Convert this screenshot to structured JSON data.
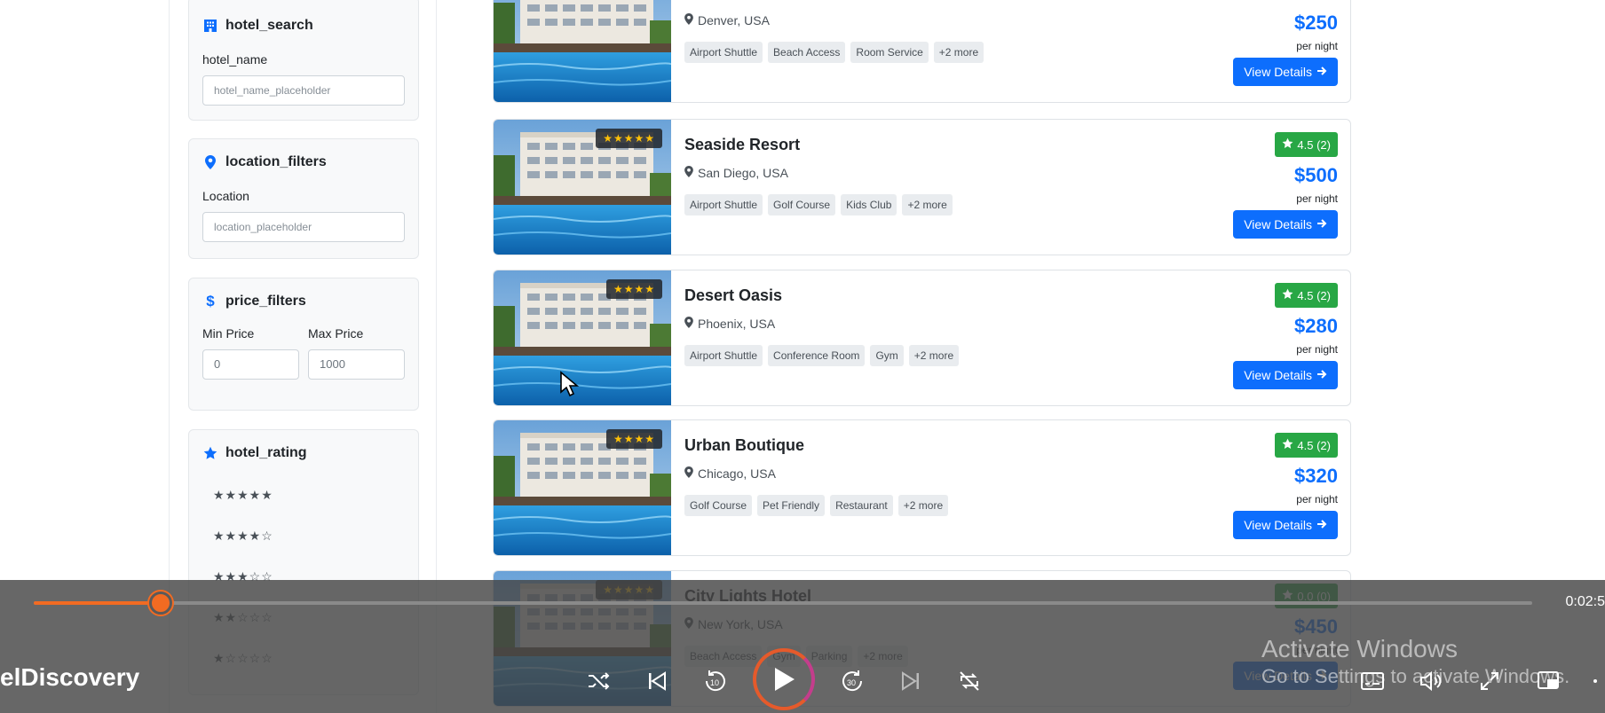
{
  "sidebar": {
    "hotel_search": {
      "title": "hotel_search",
      "label": "hotel_name",
      "placeholder": "hotel_name_placeholder"
    },
    "location_filters": {
      "title": "location_filters",
      "label": "Location",
      "placeholder": "location_placeholder"
    },
    "price_filters": {
      "title": "price_filters",
      "min_label": "Min Price",
      "min_value": "0",
      "max_label": "Max Price",
      "max_value": "1000"
    },
    "hotel_rating": {
      "title": "hotel_rating",
      "options": [
        "★★★★★",
        "★★★★☆",
        "★★★☆☆",
        "★★☆☆☆",
        "★☆☆☆☆"
      ]
    }
  },
  "hotels": [
    {
      "name": "",
      "stars": "",
      "location": "Denver, USA",
      "amenities": [
        "Airport Shuttle",
        "Beach Access",
        "Room Service",
        "+2 more"
      ],
      "rating": "",
      "price": "$250",
      "per_night": "per night",
      "button": "View Details"
    },
    {
      "name": "Seaside Resort",
      "stars": "★★★★★",
      "location": "San Diego, USA",
      "amenities": [
        "Airport Shuttle",
        "Golf Course",
        "Kids Club",
        "+2 more"
      ],
      "rating": "4.5 (2)",
      "price": "$500",
      "per_night": "per night",
      "button": "View Details"
    },
    {
      "name": "Desert Oasis",
      "stars": "★★★★",
      "location": "Phoenix, USA",
      "amenities": [
        "Airport Shuttle",
        "Conference Room",
        "Gym",
        "+2 more"
      ],
      "rating": "4.5 (2)",
      "price": "$280",
      "per_night": "per night",
      "button": "View Details"
    },
    {
      "name": "Urban Boutique",
      "stars": "★★★★",
      "location": "Chicago, USA",
      "amenities": [
        "Golf Course",
        "Pet Friendly",
        "Restaurant",
        "+2 more"
      ],
      "rating": "4.5 (2)",
      "price": "$320",
      "per_night": "per night",
      "button": "View Details"
    },
    {
      "name": "City Lights Hotel",
      "stars": "★★★★★",
      "location": "New York, USA",
      "amenities": [
        "Beach Access",
        "Gym",
        "Parking",
        "+2 more"
      ],
      "rating": "0.0 (0)",
      "price": "$450",
      "per_night": "per night",
      "button": "View Details"
    }
  ],
  "player": {
    "title": "elDiscovery",
    "time_left": "",
    "time_right": "0:02:5",
    "progress": 0.085,
    "accent": "#f26b22"
  },
  "watermark": {
    "line1": "Activate Windows",
    "line2": "Go to Settings to activate Windows."
  }
}
